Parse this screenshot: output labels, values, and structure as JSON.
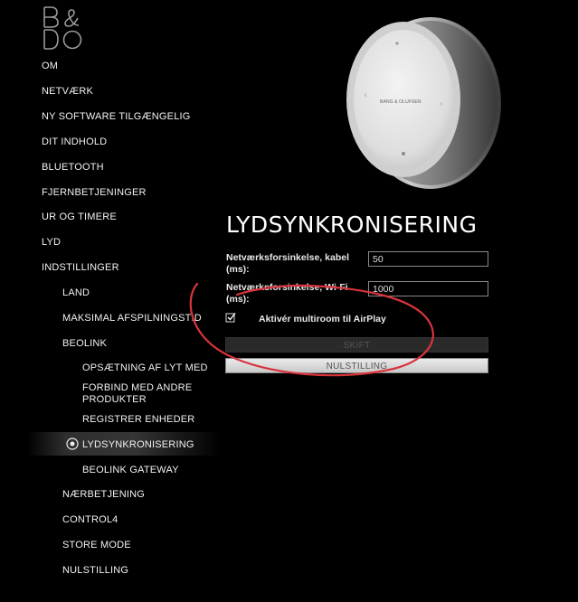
{
  "brand": {
    "logo": "B&O"
  },
  "nav": {
    "items": [
      {
        "label": "OM"
      },
      {
        "label": "NETVÆRK"
      },
      {
        "label": "NY SOFTWARE TILGÆNGELIG"
      },
      {
        "label": "DIT INDHOLD"
      },
      {
        "label": "BLUETOOTH"
      },
      {
        "label": "FJERNBETJENINGER"
      },
      {
        "label": "UR OG TIMERE"
      },
      {
        "label": "LYD"
      },
      {
        "label": "INDSTILLINGER"
      },
      {
        "label": "LAND"
      },
      {
        "label": "MAKSIMAL AFSPILNINGSTID"
      },
      {
        "label": "BEOLINK"
      },
      {
        "label": "OPSÆTNING AF LYT MED"
      },
      {
        "label": "FORBIND MED ANDRE PRODUKTER"
      },
      {
        "label": "REGISTRER ENHEDER"
      },
      {
        "label": "LYDSYNKRONISERING"
      },
      {
        "label": "BEOLINK GATEWAY"
      },
      {
        "label": "NÆRBETJENING"
      },
      {
        "label": "CONTROL4"
      },
      {
        "label": "STORE MODE"
      },
      {
        "label": "NULSTILLING"
      }
    ],
    "selected": "LYDSYNKRONISERING"
  },
  "device": {
    "brand_text": "BANG & OLUFSEN"
  },
  "main": {
    "title": "LYDSYNKRONISERING",
    "fields": [
      {
        "label": "Netværksforsinkelse, kabel (ms):",
        "value": "50"
      },
      {
        "label": "Netværksforsinkelse, Wi-Fi (ms):",
        "value": "1000"
      }
    ],
    "checkbox": {
      "label": "Aktivér multiroom til AirPlay",
      "checked": true
    },
    "buttons": {
      "skift": "SKIFT",
      "nulstilling": "NULSTILLING"
    }
  },
  "colors": {
    "background": "#000000",
    "annotation": "#d8343c"
  }
}
